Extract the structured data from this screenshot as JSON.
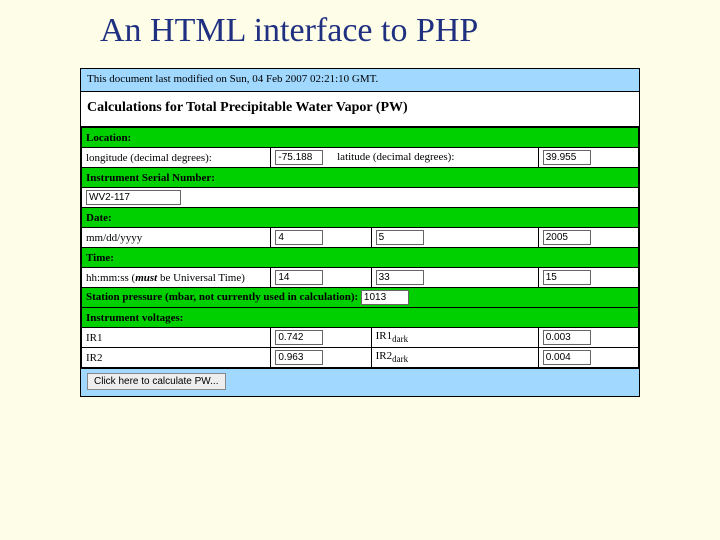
{
  "slide": {
    "title": "An HTML interface to PHP"
  },
  "header": {
    "modified": "This document last modified on Sun, 04 Feb 2007 02:21:10 GMT.",
    "calc_title": "Calculations for Total Precipitable Water Vapor (PW)"
  },
  "sections": {
    "location": "Location:",
    "serial": "Instrument Serial Number:",
    "date": "Date:",
    "time": "Time:",
    "pressure_label": "Station pressure (mbar, not currently used in calculation):",
    "voltages": "Instrument voltages:"
  },
  "labels": {
    "longitude": "longitude (decimal degrees):",
    "latitude": "latitude (decimal degrees):",
    "mmddyyyy": "mm/dd/yyyy",
    "hhmmss_prefix": "hh:mm:ss (",
    "hhmmss_must": "must",
    "hhmmss_suffix": " be Universal Time)",
    "IR1": "IR1",
    "IR1dark": "IR1",
    "IR1dark_sub": "dark",
    "IR2": "IR2",
    "IR2dark": "IR2",
    "IR2dark_sub": "dark"
  },
  "values": {
    "longitude": "-75.188",
    "latitude": "39.955",
    "serial": "WV2-117",
    "month": "4",
    "day": "5",
    "year": "2005",
    "hour": "14",
    "minute": "33",
    "second": "15",
    "pressure": "1013",
    "IR1": "0.742",
    "IR1dark": "0.003",
    "IR2": "0.963",
    "IR2dark": "0.004"
  },
  "button": {
    "calc": "Click here to calculate PW..."
  }
}
